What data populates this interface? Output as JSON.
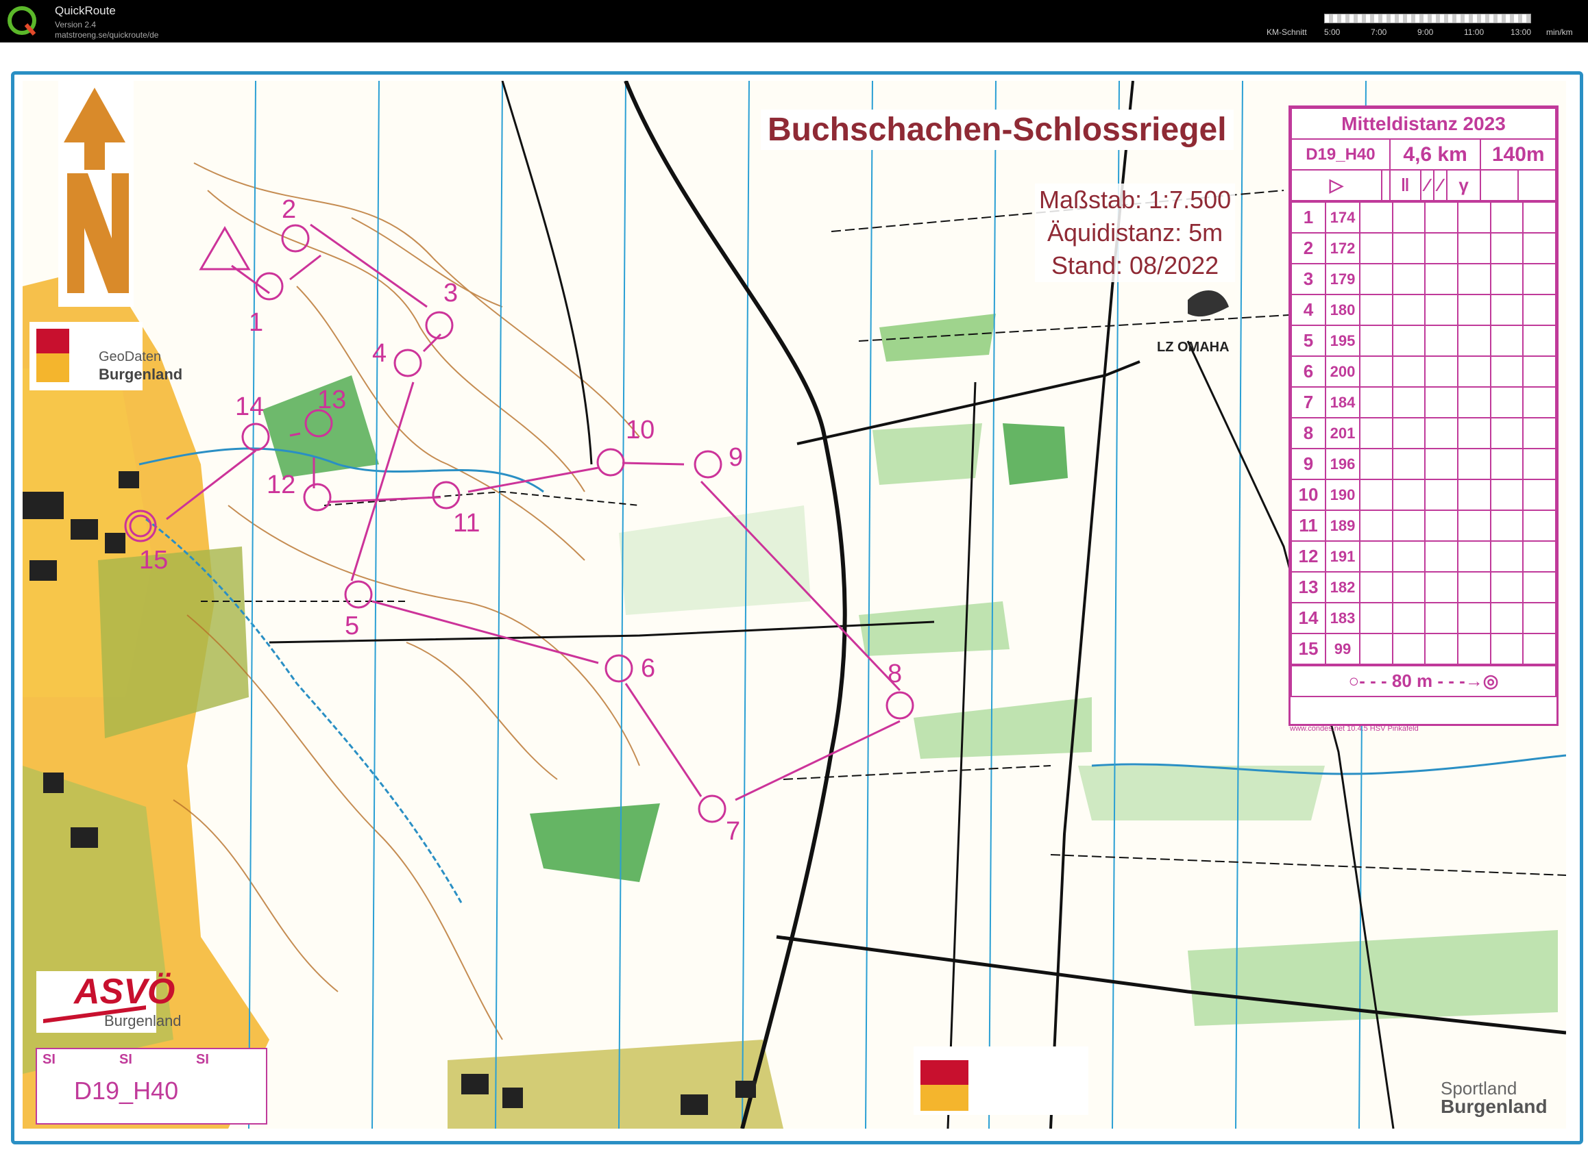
{
  "app": {
    "name": "QuickRoute",
    "version": "Version 2.4",
    "url": "matstroeng.se/quickroute/de",
    "scale_label": "KM-Schnitt",
    "scale_ticks": [
      "5:00",
      "7:00",
      "9:00",
      "11:00",
      "13:00"
    ],
    "scale_unit": "min/km"
  },
  "map": {
    "title": "Buchschachen-Schlossriegel",
    "scale": "Maßstab: 1:7.500",
    "contour": "Äquidistanz: 5m",
    "date": "Stand: 08/2022",
    "club": "LZ OMAHA",
    "logo_geodaten_top": "GeoDaten",
    "logo_geodaten_bottom": "Burgenland",
    "logo_asvo_top": "ASVÖ",
    "logo_asvo_bottom": "Burgenland",
    "logo_sportland_top": "Sportland",
    "logo_sportland_bottom": "Burgenland",
    "course_box": {
      "si1": "SI",
      "si2": "SI",
      "si3": "SI",
      "course": "D19_H40"
    },
    "footer_url": "www.condes.net 10.4.5 HSV Pinkafeld",
    "colors": {
      "course": "#cc3399",
      "water": "#2a8fc4",
      "title": "#8f2a35"
    }
  },
  "description": {
    "event": "Mitteldistanz 2023",
    "course": "D19_H40",
    "length": "4,6 km",
    "climb": "140m",
    "controls": [
      {
        "no": "1",
        "code": "174"
      },
      {
        "no": "2",
        "code": "172"
      },
      {
        "no": "3",
        "code": "179"
      },
      {
        "no": "4",
        "code": "180"
      },
      {
        "no": "5",
        "code": "195"
      },
      {
        "no": "6",
        "code": "200"
      },
      {
        "no": "7",
        "code": "184"
      },
      {
        "no": "8",
        "code": "201"
      },
      {
        "no": "9",
        "code": "196"
      },
      {
        "no": "10",
        "code": "190"
      },
      {
        "no": "11",
        "code": "189"
      },
      {
        "no": "12",
        "code": "191"
      },
      {
        "no": "13",
        "code": "182"
      },
      {
        "no": "14",
        "code": "183"
      },
      {
        "no": "15",
        "code": "99"
      }
    ],
    "finish": "80 m"
  }
}
